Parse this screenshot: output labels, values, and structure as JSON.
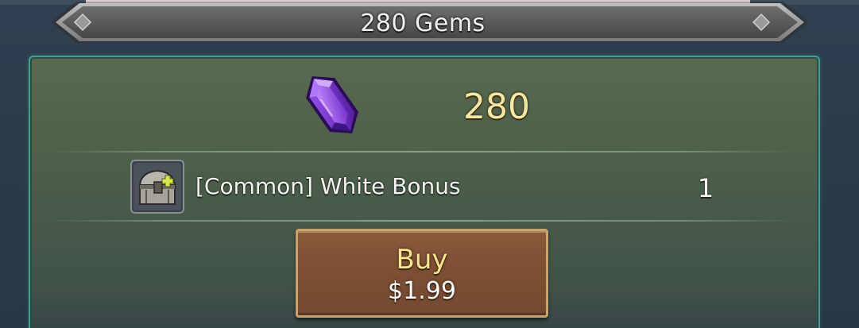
{
  "header": {
    "title": "280 Gems"
  },
  "offer": {
    "gem_amount": "280",
    "gem_icon": "purple-gem-icon",
    "bonus": {
      "icon": "treasure-chest-icon",
      "label": "[Common] White Bonus",
      "quantity": "1"
    }
  },
  "buy_button": {
    "label": "Buy",
    "price": "$1.99"
  },
  "colors": {
    "panel_border": "#3fa08e",
    "gem_amount_text": "#f7e7a0",
    "buy_label_text": "#f9e48f",
    "buy_button_fill": "#7d4f33",
    "buy_button_border": "#c8a36a",
    "gem_purple": "#8a3fe0"
  }
}
